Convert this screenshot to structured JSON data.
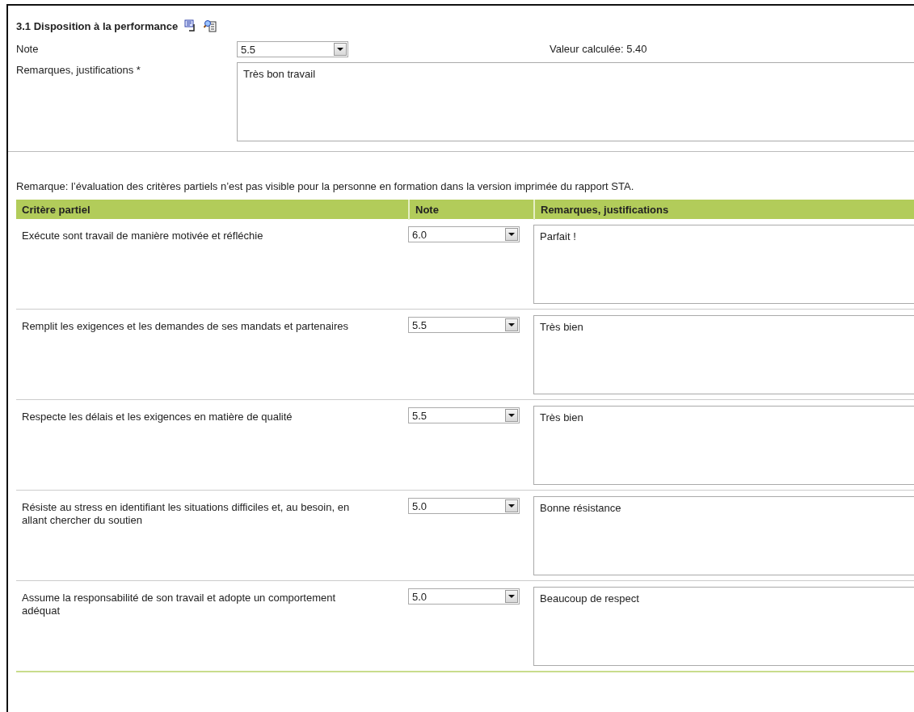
{
  "section": {
    "title": "3.1 Disposition à la performance",
    "note_label": "Note",
    "note_value": "5.5",
    "calculated": "Valeur calculée: 5.40",
    "remarks_label": "Remarques, justifications *",
    "remarks_value": "Très bon travail"
  },
  "notice": "Remarque: l’évaluation des critères partiels n’est pas visible pour la personne en formation dans la version imprimée du rapport STA.",
  "table": {
    "columns": [
      "Critère partiel",
      "Note",
      "Remarques, justifications"
    ],
    "rows": [
      {
        "criterion": "Exécute sont travail de manière motivée et réfléchie",
        "note": "6.0",
        "remarks": "Parfait !"
      },
      {
        "criterion": "Remplit les exigences et les demandes de ses mandats et partenaires",
        "note": "5.5",
        "remarks": "Très bien"
      },
      {
        "criterion": "Respecte les délais et les exigences en matière de qualité",
        "note": "5.5",
        "remarks": "Très bien"
      },
      {
        "criterion": "Résiste au stress en identifiant les situations difficiles et, au besoin, en allant chercher du soutien",
        "note": "5.0",
        "remarks": "Bonne résistance"
      },
      {
        "criterion": "Assume la responsabilité de son travail et adopte un comportement adéquat",
        "note": "5.0",
        "remarks": "Beaucoup de respect"
      }
    ]
  }
}
